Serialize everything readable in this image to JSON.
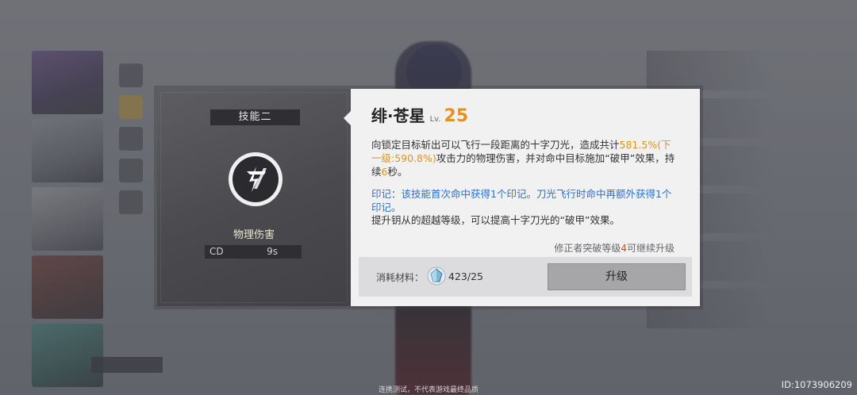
{
  "skill_panel": {
    "slot_label": "技能二",
    "icon": "cross-slash-skill-icon",
    "damage_type": "物理伤害",
    "cd_label": "CD",
    "cd_value": "9s"
  },
  "detail": {
    "name": "绯·苍星",
    "lv_label": "Lv.",
    "level": "25",
    "desc_part1": "向锁定目标斩出可以飞行一段距离的十字刀光，造成共计",
    "desc_highlight": "581.5%(下一级:590.8%)",
    "desc_part2": "攻击力的物理伤害，并对命中目标施加“破甲”效果，持续",
    "desc_duration": "6",
    "desc_part3": "秒。",
    "mark_text": "印记：该技能首次命中获得1个印记。刀光飞行时命中再额外获得1个印记。",
    "upgrade_text": "提升钥从的超越等级，可以提高十字刀光的“破甲”效果。",
    "breakthrough_prefix": "修正者突破等级",
    "breakthrough_level": "4",
    "breakthrough_suffix": "可继续升级",
    "cost_label": "消耗材料：",
    "material_icon": "crystal-material-icon",
    "material_count": "423/25",
    "upgrade_button": "升级"
  },
  "footer_note": "连携测试，不代表游戏最终品质",
  "user_id": "ID:1073906209",
  "colors": {
    "accent_orange": "#e8901c",
    "mark_blue": "#2f6fc8",
    "warning_red": "#d8432f"
  }
}
